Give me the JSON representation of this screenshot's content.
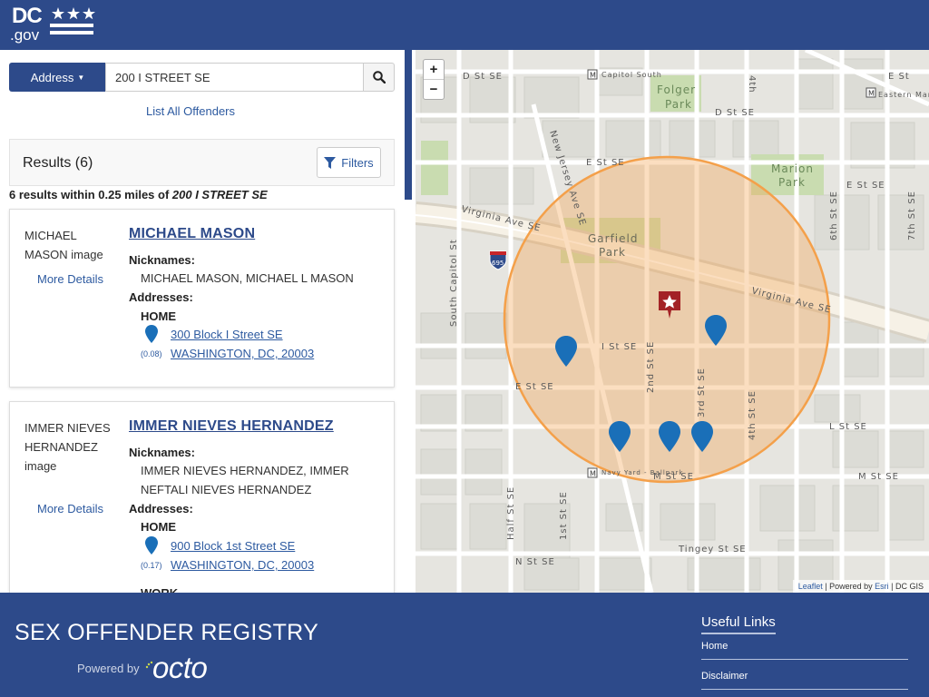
{
  "header": {
    "logo_dc": "DC",
    "logo_gov": ".gov"
  },
  "search": {
    "mode_label": "Address",
    "value": "200 I STREET SE"
  },
  "list_all_label": "List All Offenders",
  "results": {
    "title": "Results (6)",
    "filters_label": "Filters",
    "summary_prefix": "6 results within 0.25 miles of",
    "summary_address": "200 I STREET SE"
  },
  "offenders": [
    {
      "image_alt": "MICHAEL MASON image",
      "more": "More Details",
      "name": "MICHAEL MASON",
      "nick_label": "Nicknames:",
      "nicknames": "MICHAEL MASON, MICHAEL L MASON",
      "addr_label": "Addresses:",
      "addr_type": "HOME",
      "street": "300 Block I Street SE",
      "distance": "(0.08)",
      "city": "WASHINGTON, DC, 20003"
    },
    {
      "image_alt": "IMMER NIEVES HERNANDEZ image",
      "more": "More Details",
      "name": "IMMER NIEVES HERNANDEZ",
      "nick_label": "Nicknames:",
      "nicknames": "IMMER NIEVES HERNANDEZ, IMMER NEFTALI NIEVES HERNANDEZ",
      "addr_label": "Addresses:",
      "addr_type": "HOME",
      "street": "900 Block 1st Street SE",
      "distance": "(0.17)",
      "city": "WASHINGTON, DC, 20003",
      "next_addr_type": "WORK"
    }
  ],
  "map": {
    "zoom_in": "+",
    "zoom_out": "−",
    "attribution": {
      "leaflet": "Leaflet",
      "mid": " | Powered by ",
      "esri": "Esri",
      "tail": " | DC GIS"
    },
    "labels": {
      "d_st_se_1": "D St SE",
      "capitol_south": "Capitol South",
      "folger": "Folger",
      "park1": "Park",
      "d_st_se_2": "D St SE",
      "eastern_market": "Eastern Market",
      "e_st_se_1": "E St SE",
      "marion": "Marion",
      "park2": "Park",
      "e_st_se_2": "E St SE",
      "virginia_ave_se_1": "Virginia Ave SE",
      "garfield": "Garfield",
      "park3": "Park",
      "new_jersey_ave_se": "New Jersey Ave SE",
      "south_capitol_st": "South Capitol St",
      "i695": "695",
      "virginia_ave_se_2": "Virginia Ave SE",
      "i_st_se": "I St SE",
      "e_st_se_3": "E St SE",
      "st_2nd_se": "2nd St SE",
      "st_3rd_se": "3rd St SE",
      "st_4th_se": "4th St SE",
      "l_st_se": "L St SE",
      "m_st_se_1": "M St SE",
      "m_st_se_2": "M St SE",
      "navy_yard": "Navy Yard - Ballpark",
      "half_st_se": "Half St SE",
      "st_1st_se": "1st St SE",
      "tingey_st_se": "Tingey St SE",
      "n_st_se": "N St SE",
      "st_6th_se": "6th St SE",
      "st_7th_se": "7th St SE",
      "e_st_3": "E St",
      "st_4th": "4th"
    }
  },
  "footer": {
    "title": "SEX OFFENDER REGISTRY",
    "powered_by": "Powered by",
    "octo": "octo",
    "useful_links": "Useful Links",
    "links": [
      "Home",
      "Disclaimer"
    ]
  },
  "colors": {
    "brand_blue": "#2d4a8a",
    "link_blue": "#2d5aa0",
    "pin_blue": "#1a6fb8",
    "center_red": "#a32226",
    "radius_orange": "#f4a04a"
  }
}
